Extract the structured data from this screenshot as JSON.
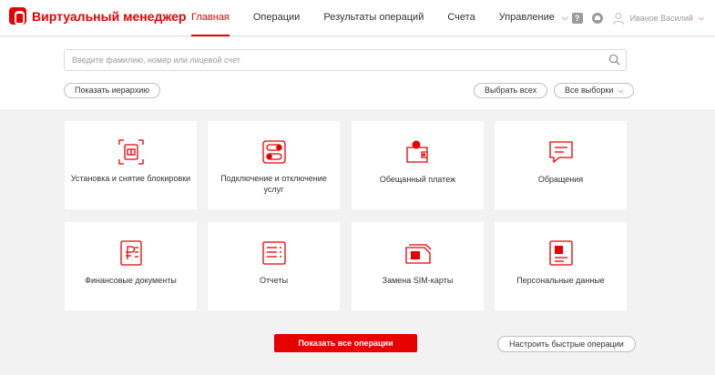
{
  "app": {
    "title": "Виртуальный менеджер"
  },
  "nav": {
    "items": [
      {
        "label": "Главная",
        "active": true
      },
      {
        "label": "Операции"
      },
      {
        "label": "Результаты операций"
      },
      {
        "label": "Счета"
      },
      {
        "label": "Управление",
        "has_dropdown": true
      }
    ]
  },
  "header_right": {
    "help_glyph": "?",
    "user_name": "Иванов Василий",
    "icons": [
      "help-icon",
      "bell-icon",
      "user-icon",
      "chevron-down-icon"
    ]
  },
  "search": {
    "placeholder": "Введите фамилию, номер или лицевой счет",
    "value": ""
  },
  "buttons": {
    "hierarchy": "Показать иерархию",
    "select_all": "Выбрать всех",
    "all_selections": "Все выборки",
    "show_all_operations": "Показать все операции",
    "configure_quick": "Настроить быстрые операции"
  },
  "tiles": [
    {
      "label": "Установка и снятие блокировки",
      "icon": "sim-lock-icon"
    },
    {
      "label": "Подключение и отключение услуг",
      "icon": "toggle-icon"
    },
    {
      "label": "Обещанный платеж",
      "icon": "wallet-icon"
    },
    {
      "label": "Обращения",
      "icon": "chat-icon"
    },
    {
      "label": "Финансовые документы",
      "icon": "ruble-document-icon"
    },
    {
      "label": "Отчеты",
      "icon": "report-icon"
    },
    {
      "label": "Замена SIM-карты",
      "icon": "sim-card-icon"
    },
    {
      "label": "Персональные данные",
      "icon": "profile-card-icon"
    }
  ],
  "colors": {
    "accent": "#e60000",
    "background": "#f2f2f2",
    "text": "#333333",
    "muted": "#9b9b9b"
  }
}
